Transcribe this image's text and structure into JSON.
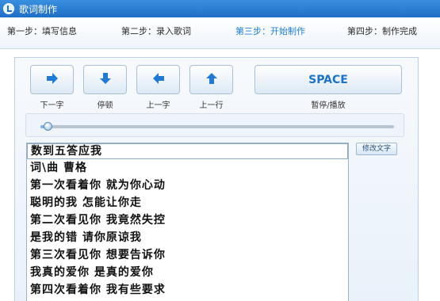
{
  "window": {
    "title": "歌词制作"
  },
  "steps": [
    {
      "label": "第一步：填写信息",
      "active": false
    },
    {
      "label": "第二步：录入歌词",
      "active": false
    },
    {
      "label": "第三步：开始制作",
      "active": true
    },
    {
      "label": "第四步：制作完成",
      "active": false
    }
  ],
  "controls": {
    "next_char": {
      "label": "下一字",
      "icon": "arrow-right-icon"
    },
    "pause": {
      "label": "停顿",
      "icon": "arrow-down-icon"
    },
    "prev_char": {
      "label": "上一字",
      "icon": "arrow-left-icon"
    },
    "prev_line": {
      "label": "上一行",
      "icon": "arrow-up-icon"
    },
    "space": {
      "key": "SPACE",
      "label": "暂停/播放"
    }
  },
  "progress": {
    "value": 0.02
  },
  "edit_button": {
    "label": "修改文字"
  },
  "lyrics": [
    "数到五答应我",
    "词\\曲  曹格",
    "第一次看着你  就为你心动",
    "聪明的我  怎能让你走",
    "第二次看见你  我竟然失控",
    "是我的错  请你原谅我",
    "第三次看见你  想要告诉你",
    "我真的爱你  是真的爱你",
    "第四次看着你  我有些要求"
  ],
  "colors": {
    "accent": "#1b7fd8",
    "arrow": "#1f7ad6",
    "titlebar": "#2a7fd6"
  }
}
